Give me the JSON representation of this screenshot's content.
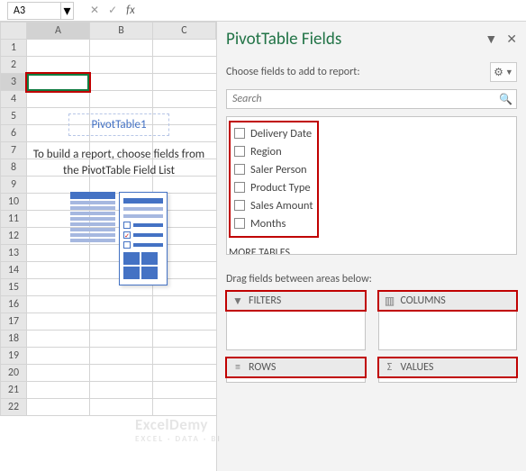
{
  "formula_bar": {
    "cell_ref": "A3",
    "cancel": "✕",
    "confirm": "✓",
    "fx": "fx"
  },
  "columns": [
    "A",
    "B",
    "C"
  ],
  "row_count": 22,
  "active_cell": "A3",
  "pivot": {
    "label": "PivotTable1",
    "instruction": "To build a report, choose fields from the PivotTable Field List"
  },
  "pane": {
    "title": "PivotTable Fields",
    "subtitle": "Choose fields to add to report:",
    "search_placeholder": "Search",
    "fields": [
      "Delivery Date",
      "Region",
      "Saler Person",
      "Product Type",
      "Sales Amount",
      "Months"
    ],
    "more_tables": "MORE TABLES...",
    "drag_instruction": "Drag fields between areas below:",
    "areas": {
      "filters": "FILTERS",
      "columns": "COLUMNS",
      "rows": "ROWS",
      "values": "VALUES"
    }
  },
  "watermark": {
    "main": "ExcelDemy",
    "sub": "EXCEL · DATA · BI"
  }
}
